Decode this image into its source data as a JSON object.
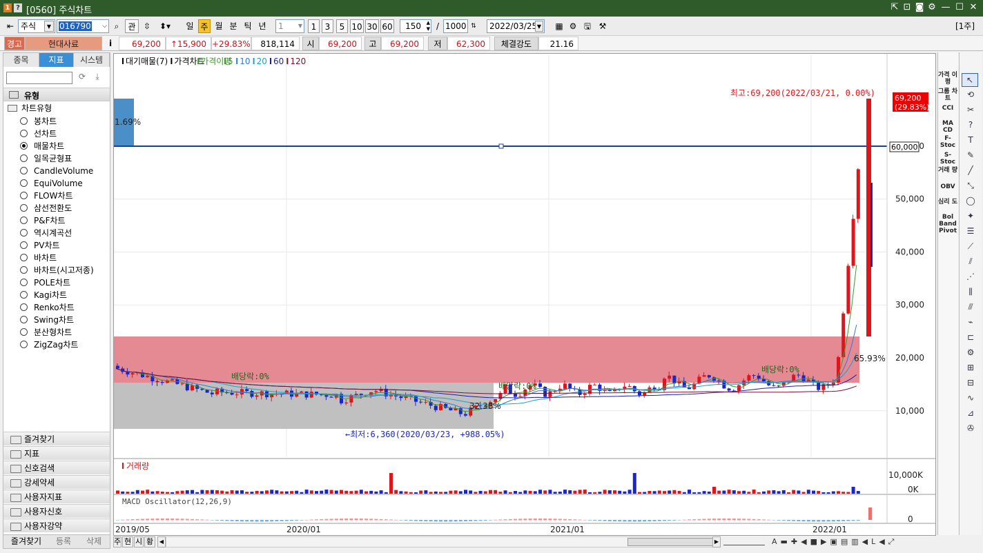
{
  "window": {
    "title": "[0560] 주식차트",
    "icon1": "1",
    "icon2": "?"
  },
  "toolbar": {
    "market": "주식",
    "code": "016790",
    "gwan": "관",
    "periods": [
      "일",
      "주",
      "월",
      "분",
      "틱",
      "년"
    ],
    "active_period": "주",
    "interval_select": "1",
    "quick": [
      "1",
      "3",
      "5",
      "10",
      "30",
      "60"
    ],
    "count": "150",
    "slash": "/",
    "total": "1000",
    "date": "2022/03/25",
    "right_unit": "[1주]"
  },
  "quote": {
    "warning": "경고",
    "name": "현대사료",
    "info": "i",
    "price": "69,200",
    "change": "↑15,900",
    "rate": "+29.83%",
    "volume": "818,114",
    "open_label": "시",
    "open": "69,200",
    "high_label": "고",
    "high": "69,200",
    "low_label": "저",
    "low": "62,300",
    "strength_label": "체결강도",
    "strength": "21.16"
  },
  "left": {
    "tabs": [
      "종목",
      "지표",
      "시스템"
    ],
    "active_tab": "지표",
    "tree_header": "유형",
    "tree_parent": "차트유형",
    "chart_types": [
      "봉차트",
      "선차트",
      "매물차트",
      "일목균형표",
      "CandleVolume",
      "EquiVolume",
      "FLOW차트",
      "삼선전환도",
      "P&F차트",
      "역시계곡선",
      "PV차트",
      "바차트",
      "바차트(시고저종)",
      "POLE차트",
      "Kagi차트",
      "Renko차트",
      "Swing차트",
      "분산형차트",
      "ZigZag차트"
    ],
    "selected_type": "매물차트",
    "folders": [
      "즐겨찾기",
      "지표",
      "신호검색",
      "강세약세",
      "사용자지표",
      "사용자신호",
      "사용자강약"
    ],
    "bottom_buttons": [
      "즐겨찾기",
      "등록",
      "삭제"
    ]
  },
  "chart": {
    "legend": [
      "대기매물(7)",
      "가격차트",
      "가격이평",
      "5",
      "10",
      "20",
      "60",
      "120"
    ],
    "y_ticks": [
      "60,000",
      "50,000",
      "40,000",
      "30,000",
      "20,000",
      "10,000"
    ],
    "x_ticks": [
      "2019/05",
      "2020/01",
      "2021/01",
      "2022/01"
    ],
    "max_label": "최고:69,200(2022/03/21, 0.00%)",
    "min_label": "←최저:6,360(2020/03/23, +988.05%)",
    "pct1": "1.69%",
    "pct2": "32.38%",
    "pct3": "65.93%",
    "div1": "배당락:0%",
    "div2": "배당락:0%",
    "div3": "배당락:0%",
    "price_tag": "69,200",
    "price_tag_rate": "(29.83%)",
    "line_tag": "60,000",
    "volume_title": "거래량",
    "volume_ticks": [
      "10,000K",
      "0K"
    ],
    "macd_title": "MACD Oscillator(12,26,9)",
    "macd_zero": "0",
    "colors": {
      "up": "#e0151b",
      "down": "#1b26c8",
      "profile_red": "#e58a93",
      "profile_gray": "#c0c0c0",
      "hline": "#1a3f8f"
    }
  },
  "right_tools1": [
    "가격 이평",
    "그룹 차트",
    "CCI",
    "MA CD",
    "F-Stoc",
    "S-Stoc",
    "거래 량",
    "OBV",
    "심리 도",
    "Bol Band",
    "Pivot"
  ],
  "bottom": {
    "tabs": [
      "주",
      "현",
      "시",
      "황"
    ]
  }
}
